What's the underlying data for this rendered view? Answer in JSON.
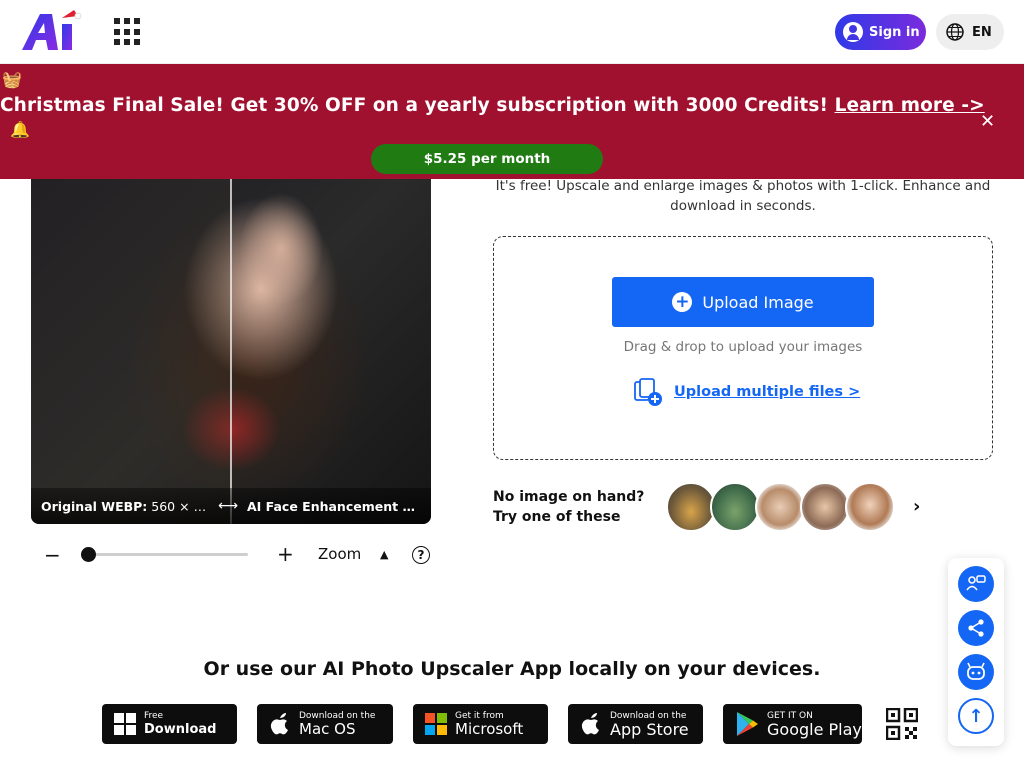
{
  "header": {
    "logo_text": "Ai",
    "signin_label": "Sign in",
    "lang_label": "EN",
    "colors": {
      "signin_gradient_start": "#2f3ae8",
      "signin_gradient_end": "#7a2bdc"
    }
  },
  "banner": {
    "text": "Christmas Final Sale! Get 30% OFF on a yearly subscription with 3000 Credits!",
    "link": "Learn more ->",
    "price_pill": "$5.25 per month",
    "close": "✕",
    "gift_icon": "🧺",
    "bells_icon": "🔔",
    "colors": {
      "background": "#a0112f",
      "pill": "#1f7b12"
    }
  },
  "preview": {
    "left_caption_bold": "Original WEBP:",
    "left_caption_value": "560 × 5...",
    "arrow": "⟷",
    "right_caption": "AI Face Enhancement W..."
  },
  "zoom": {
    "minus": "−",
    "plus": "+",
    "label": "Zoom",
    "caret": "▲",
    "help": "?",
    "level_fraction": 0.0
  },
  "upload": {
    "subtitle": "It's free! Upscale and enlarge images & photos with 1-click. Enhance and download in seconds.",
    "button_label": "Upload Image",
    "plus": "+",
    "drag_text": "Drag & drop to upload your images",
    "multi_link": "Upload multiple files >",
    "accent": "#1466f4"
  },
  "samples": {
    "prompt_line1": "No image on hand?",
    "prompt_line2": "Try one of these",
    "next": "›"
  },
  "float": {
    "feedback_icon": "feedback-icon",
    "share_icon": "share-icon",
    "bot_icon": "bot-icon",
    "top": "↑"
  },
  "apps": {
    "title": "Or use our AI Photo Upscaler App locally on your devices.",
    "stores": [
      {
        "small": "Free",
        "big": "Download"
      },
      {
        "small": "Download on the",
        "big": "Mac OS"
      },
      {
        "small": "Get it from",
        "big": "Microsoft"
      },
      {
        "small": "Download on the",
        "big": "App Store"
      },
      {
        "small": "GET IT ON",
        "big": "Google Play"
      }
    ]
  }
}
